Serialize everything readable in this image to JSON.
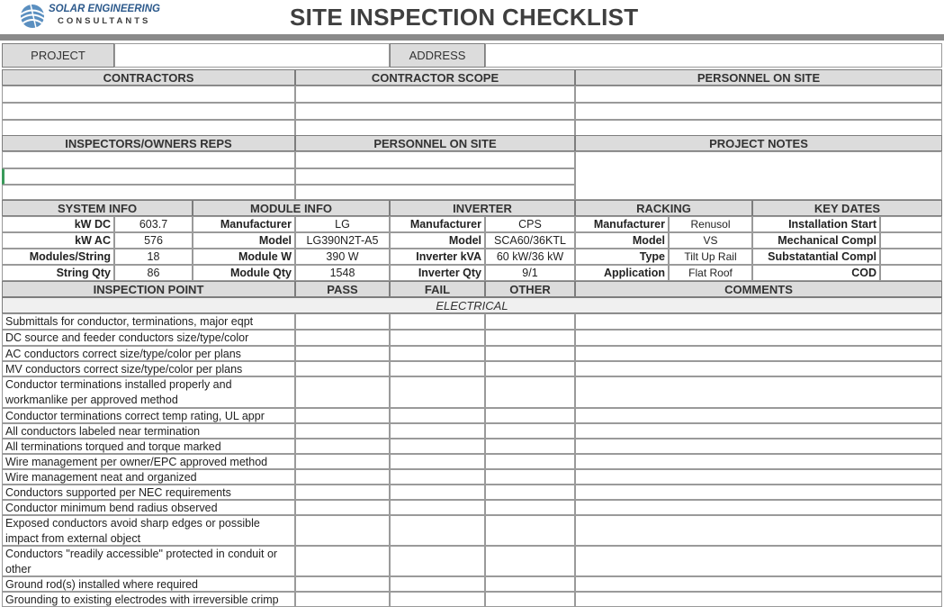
{
  "logo": {
    "line1": "SOLAR ENGINEERING",
    "line2": "CONSULTANTS"
  },
  "title": "SITE INSPECTION CHECKLIST",
  "project": {
    "project_label": "PROJECT",
    "project_value": "",
    "address_label": "ADDRESS",
    "address_value": ""
  },
  "team_headers": {
    "contractors": "CONTRACTORS",
    "contractor_scope": "CONTRACTOR SCOPE",
    "personnel_on_site": "PERSONNEL ON SITE"
  },
  "reps_headers": {
    "inspectors": "INSPECTORS/OWNERS REPS",
    "personnel_on_site": "PERSONNEL ON SITE",
    "project_notes": "PROJECT NOTES"
  },
  "info_headers": {
    "system": "SYSTEM INFO",
    "module": "MODULE INFO",
    "inverter": "INVERTER",
    "racking": "RACKING",
    "key_dates": "KEY DATES"
  },
  "system_info": [
    {
      "label": "kW DC",
      "value": "603.7"
    },
    {
      "label": "kW AC",
      "value": "576"
    },
    {
      "label": "Modules/String",
      "value": "18"
    },
    {
      "label": "String Qty",
      "value": "86"
    }
  ],
  "module_info": [
    {
      "label": "Manufacturer",
      "value": "LG"
    },
    {
      "label": "Model",
      "value": "LG390N2T-A5"
    },
    {
      "label": "Module W",
      "value": "390 W"
    },
    {
      "label": "Module Qty",
      "value": "1548"
    }
  ],
  "inverter_info": [
    {
      "label": "Manufacturer",
      "value": "CPS"
    },
    {
      "label": "Model",
      "value": "SCA60/36KTL"
    },
    {
      "label": "Inverter kVA",
      "value": "60 kW/36 kW"
    },
    {
      "label": "Inverter Qty",
      "value": "9/1"
    }
  ],
  "racking_info": [
    {
      "label": "Manufacturer",
      "value": "Renusol"
    },
    {
      "label": "Model",
      "value": "VS"
    },
    {
      "label": "Type",
      "value": "Tilt Up Rail"
    },
    {
      "label": "Application",
      "value": "Flat Roof"
    }
  ],
  "key_dates": [
    {
      "label": "Installation Start",
      "value": ""
    },
    {
      "label": "Mechanical Compl",
      "value": ""
    },
    {
      "label": "Substatantial Compl",
      "value": ""
    },
    {
      "label": "COD",
      "value": ""
    }
  ],
  "checklist_headers": {
    "point": "INSPECTION POINT",
    "pass": "PASS",
    "fail": "FAIL",
    "other": "OTHER",
    "comments": "COMMENTS"
  },
  "section_electrical": "ELECTRICAL",
  "checklist_items": [
    {
      "text": "Submittals for conductor, terminations, major eqpt"
    },
    {
      "text": "DC source and feeder conductors size/type/color"
    },
    {
      "text": "AC conductors correct size/type/color per plans"
    },
    {
      "text": "MV conductors correct size/type/color per plans"
    },
    {
      "text": "Conductor terminations installed properly and workmanlike per approved method"
    },
    {
      "text": "Conductor terminations correct temp rating, UL appr"
    },
    {
      "text": "All conductors labeled near termination"
    },
    {
      "text": "All terminations torqued and torque marked"
    },
    {
      "text": "Wire management per owner/EPC approved method"
    },
    {
      "text": "Wire management neat and organized"
    },
    {
      "text": "Conductors supported per NEC requirements"
    },
    {
      "text": "Conductor minimum bend radius observed"
    },
    {
      "text": "Exposed conductors avoid sharp edges or possible impact from external object"
    },
    {
      "text": "Conductors \"readily accessible\" protected in conduit or other"
    },
    {
      "text": "Ground rod(s) installed where required"
    },
    {
      "text": "Grounding to existing electrodes with irreversible crimp"
    }
  ],
  "colors": {
    "header_bg": "#dcdcdc",
    "border": "#7d7d7d",
    "logo_blue": "#2d5a8c",
    "title": "#3f3f3f"
  }
}
